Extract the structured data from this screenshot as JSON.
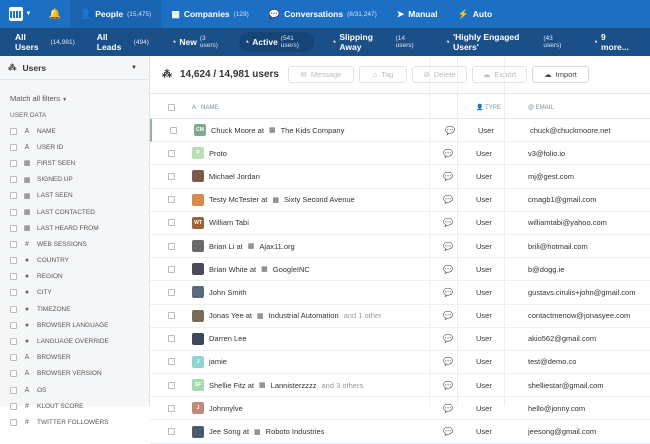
{
  "topbar": {
    "nav": [
      {
        "label": "People",
        "count": "(15,475)",
        "icon": "person-icon",
        "active": true
      },
      {
        "label": "Companies",
        "count": "(129)",
        "icon": "building-icon",
        "active": false
      },
      {
        "label": "Conversations",
        "count": "(8/31,247)",
        "icon": "chat-icon",
        "active": false
      },
      {
        "label": "Manual",
        "count": "",
        "icon": "send-icon",
        "active": false
      },
      {
        "label": "Auto",
        "count": "",
        "icon": "bolt-icon",
        "active": false
      }
    ]
  },
  "segments": [
    {
      "label": "All Users",
      "count": "(14,981)",
      "active": false
    },
    {
      "label": "All Leads",
      "count": "(494)",
      "active": false
    },
    {
      "label": "New",
      "count": "(3 users)",
      "active": false
    },
    {
      "label": "Active",
      "count": "(541 users)",
      "active": true
    },
    {
      "label": "Slipping Away",
      "count": "(14 users)",
      "active": false
    },
    {
      "label": "'Highly Engaged Users'",
      "count": "(43 users)",
      "active": false
    },
    {
      "label": "9 more...",
      "count": "",
      "active": false
    }
  ],
  "sidebar": {
    "title": "Users",
    "match": "Match all filters",
    "section": "USER DATA",
    "attributes": [
      {
        "label": "NAME",
        "icon": "a"
      },
      {
        "label": "USER ID",
        "icon": "a"
      },
      {
        "label": "FIRST SEEN",
        "icon": "cal"
      },
      {
        "label": "SIGNED UP",
        "icon": "cal"
      },
      {
        "label": "LAST SEEN",
        "icon": "cal"
      },
      {
        "label": "LAST CONTACTED",
        "icon": "cal"
      },
      {
        "label": "LAST HEARD FROM",
        "icon": "cal"
      },
      {
        "label": "WEB SESSIONS",
        "icon": "num"
      },
      {
        "label": "COUNTRY",
        "icon": "globe"
      },
      {
        "label": "REGION",
        "icon": "globe"
      },
      {
        "label": "CITY",
        "icon": "globe"
      },
      {
        "label": "TIMEZONE",
        "icon": "globe"
      },
      {
        "label": "BROWSER LANGUAGE",
        "icon": "globe"
      },
      {
        "label": "LANGUAGE OVERRIDE",
        "icon": "globe"
      },
      {
        "label": "BROWSER",
        "icon": "a"
      },
      {
        "label": "BROWSER VERSION",
        "icon": "a"
      },
      {
        "label": "OS",
        "icon": "a"
      },
      {
        "label": "KLOUT SCORE",
        "icon": "num"
      },
      {
        "label": "TWITTER FOLLOWERS",
        "icon": "num"
      }
    ]
  },
  "main": {
    "count_label": "14,624 / 14,981 users",
    "actions": [
      "Message",
      "Tag",
      "Delete",
      "Export",
      "Import"
    ],
    "columns": {
      "name": "Name",
      "type": "Type",
      "email": "Email"
    },
    "rows": [
      {
        "name": "Chuck Moore at",
        "company": "The Kids Company",
        "more": "",
        "type": "User",
        "email": "chuck@chuckmoore.net",
        "initials": "CM",
        "color": "#7fa88f"
      },
      {
        "name": "Proto",
        "company": "",
        "more": "",
        "type": "User",
        "email": "v3@folio.io",
        "initials": "P",
        "color": "#b9e0b2"
      },
      {
        "name": "Michael Jordan",
        "company": "",
        "more": "",
        "type": "User",
        "email": "mj@gest.com",
        "initials": "",
        "color": "#7a5a4a"
      },
      {
        "name": "Testy McTester at",
        "company": "Sixty Second Avenue",
        "more": "",
        "type": "User",
        "email": "cmagb1@gmail.com",
        "initials": "",
        "color": "#d98a4b"
      },
      {
        "name": "William Tabi",
        "company": "",
        "more": "",
        "type": "User",
        "email": "williamtabi@yahoo.com",
        "initials": "WT",
        "color": "#a0613a"
      },
      {
        "name": "Brian Li at",
        "company": "Ajax11.org",
        "more": "",
        "type": "User",
        "email": "brili@hotmail.com",
        "initials": "",
        "color": "#6a6a6a"
      },
      {
        "name": "Brian White at",
        "company": "GoogleINC",
        "more": "",
        "type": "User",
        "email": "b@dogg.ie",
        "initials": "",
        "color": "#4a4a5a"
      },
      {
        "name": "John Smith",
        "company": "",
        "more": "",
        "type": "User",
        "email": "gustavs.cirulis+john@gmail.com",
        "initials": "",
        "color": "#5a6a7a"
      },
      {
        "name": "Jonas Yee at",
        "company": "Industrial Automation",
        "more": "and 1 other",
        "type": "User",
        "email": "contactmenow@jonasyee.com",
        "initials": "",
        "color": "#7a6a5a"
      },
      {
        "name": "Darren Lee",
        "company": "",
        "more": "",
        "type": "User",
        "email": "akio562@gmail.com",
        "initials": "",
        "color": "#3a4a5a"
      },
      {
        "name": "jamie",
        "company": "",
        "more": "",
        "type": "User",
        "email": "test@demo.co",
        "initials": "J",
        "color": "#8fd6d0"
      },
      {
        "name": "Shellie Fitz at",
        "company": "Lannisterzzzz",
        "more": "and 3 others",
        "type": "User",
        "email": "shelliestar@gmail.com",
        "initials": "SF",
        "color": "#a6d9b0"
      },
      {
        "name": "Johnnylve",
        "company": "",
        "more": "",
        "type": "User",
        "email": "hello@jonny.com",
        "initials": "J",
        "color": "#c08a7a"
      },
      {
        "name": "Jee Song at",
        "company": "Roboto Industries",
        "more": "",
        "type": "User",
        "email": "jeesong@gmail.com",
        "initials": "",
        "color": "#4a5a6a"
      }
    ]
  }
}
